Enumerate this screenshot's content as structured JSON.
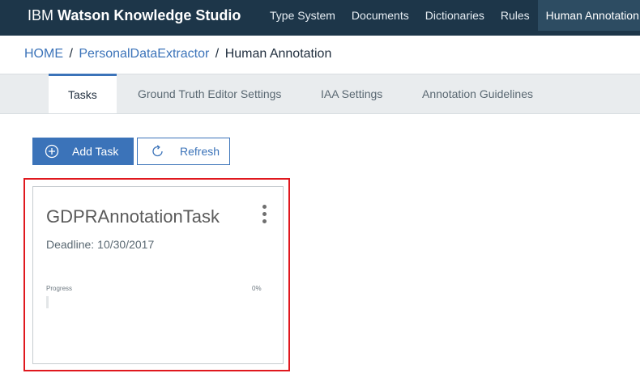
{
  "header": {
    "brand_prefix": "IBM",
    "brand_name": "Watson Knowledge Studio",
    "nav": [
      {
        "label": "Type System"
      },
      {
        "label": "Documents"
      },
      {
        "label": "Dictionaries"
      },
      {
        "label": "Rules"
      },
      {
        "label": "Human Annotation",
        "active": true
      }
    ]
  },
  "breadcrumb": {
    "items": [
      "HOME",
      "PersonalDataExtractor",
      "Human Annotation"
    ],
    "separator": "/"
  },
  "tabs": [
    {
      "label": "Tasks",
      "active": true
    },
    {
      "label": "Ground Truth Editor Settings"
    },
    {
      "label": "IAA Settings"
    },
    {
      "label": "Annotation Guidelines"
    }
  ],
  "toolbar": {
    "add_task_label": "Add Task",
    "refresh_label": "Refresh"
  },
  "task_card": {
    "title": "GDPRAnnotationTask",
    "deadline_label": "Deadline:",
    "deadline_value": "10/30/2017",
    "progress_label": "Progress",
    "progress_value_text": "0%",
    "progress_fraction": 0
  },
  "colors": {
    "topbar": "#1d3649",
    "accent": "#3b73b9",
    "highlight": "#e0181e"
  }
}
